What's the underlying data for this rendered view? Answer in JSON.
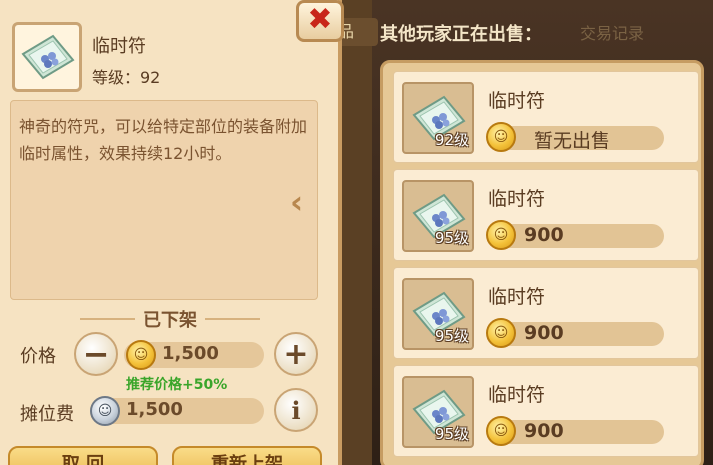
{
  "left": {
    "item_name": "临时符",
    "level_text": "等级：92",
    "description": "神奇的符咒，可以给特定部位的装备附加临时属性，效果持续12小时。",
    "status": "已下架",
    "price_label": "价格",
    "price_value": "1,500",
    "recommend_text": "推荐价格+50%",
    "fee_label": "摊位费",
    "fee_value": "1,500",
    "minus_symbol": "−",
    "plus_symbol": "+",
    "info_symbol": "i",
    "bottom_left_label": "取 回",
    "bottom_right_label": "重新上架",
    "close_symbol": "✖"
  },
  "right": {
    "header": "其他玩家正在出售：",
    "ghost_header": "交易记录",
    "tab_partial": "品",
    "listings": [
      {
        "name": "临时符",
        "level": "92级",
        "amount": "暂无出售"
      },
      {
        "name": "临时符",
        "level": "95级",
        "amount": "900"
      },
      {
        "name": "临时符",
        "level": "95级",
        "amount": "900"
      },
      {
        "name": "临时符",
        "level": "95级",
        "amount": "900"
      }
    ]
  },
  "colors": {
    "panel_bg": "#f6e3c2",
    "accent_gold": "#f4c23a",
    "recommend_green": "#3aa52a",
    "close_red": "#c8261a"
  },
  "icons": [
    "talisman-icon",
    "gold-coin-icon",
    "silver-coin-icon",
    "close-icon",
    "chevron-left-icon",
    "minus-icon",
    "plus-icon",
    "info-icon"
  ]
}
